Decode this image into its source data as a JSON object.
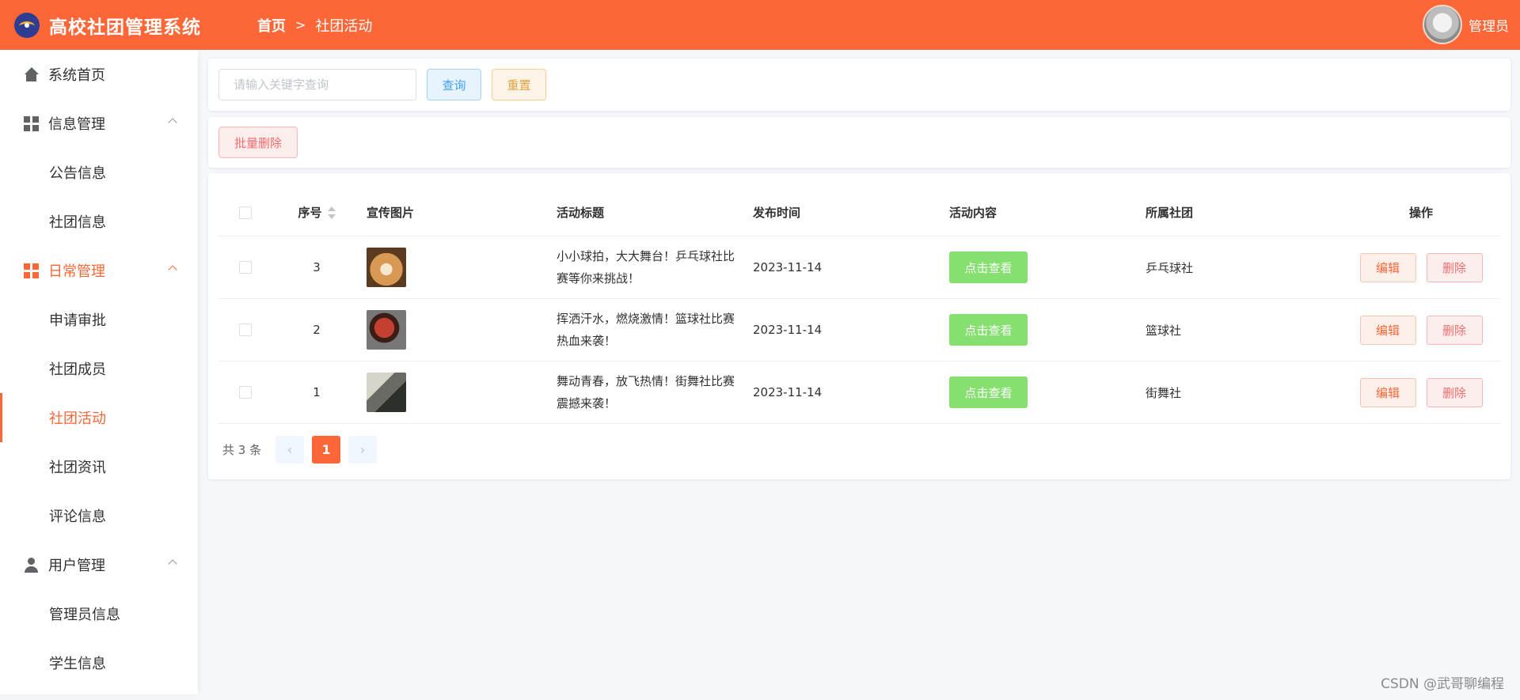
{
  "header": {
    "app_title": "高校社团管理系统",
    "breadcrumb_home": "首页",
    "breadcrumb_sep": ">",
    "breadcrumb_current": "社团活动",
    "admin_name": "管理员",
    "accent_color": "#fd6737"
  },
  "sidebar": {
    "items": [
      {
        "label": "系统首页",
        "icon": "home-icon"
      },
      {
        "label": "信息管理",
        "icon": "grid-icon"
      },
      {
        "label": "公告信息"
      },
      {
        "label": "社团信息"
      },
      {
        "label": "日常管理",
        "icon": "grid-icon"
      },
      {
        "label": "申请审批"
      },
      {
        "label": "社团成员"
      },
      {
        "label": "社团活动"
      },
      {
        "label": "社团资讯"
      },
      {
        "label": "评论信息"
      },
      {
        "label": "用户管理",
        "icon": "user-icon"
      },
      {
        "label": "管理员信息"
      },
      {
        "label": "学生信息"
      }
    ]
  },
  "search": {
    "placeholder": "请输入关键字查询",
    "query_label": "查询",
    "reset_label": "重置"
  },
  "toolbar": {
    "batch_delete_label": "批量删除"
  },
  "table": {
    "columns": {
      "index": "序号",
      "image": "宣传图片",
      "title": "活动标题",
      "time": "发布时间",
      "content": "活动内容",
      "club": "所属社团",
      "ops": "操作"
    },
    "rows": [
      {
        "index": "3",
        "title": "小小球拍，大大舞台！乒乓球社比赛等你来挑战！",
        "time": "2023-11-14",
        "view_label": "点击查看",
        "club": "乒乓球社",
        "edit_label": "编辑",
        "delete_label": "删除"
      },
      {
        "index": "2",
        "title": "挥洒汗水，燃烧激情！篮球社比赛热血来袭！",
        "time": "2023-11-14",
        "view_label": "点击查看",
        "club": "篮球社",
        "edit_label": "编辑",
        "delete_label": "删除"
      },
      {
        "index": "1",
        "title": "舞动青春，放飞热情！街舞社比赛震撼来袭！",
        "time": "2023-11-14",
        "view_label": "点击查看",
        "club": "街舞社",
        "edit_label": "编辑",
        "delete_label": "删除"
      }
    ]
  },
  "pagination": {
    "total_text": "共 3 条",
    "current_page": "1",
    "prev_icon": "‹",
    "next_icon": "›"
  },
  "watermark": "CSDN @武哥聊编程"
}
